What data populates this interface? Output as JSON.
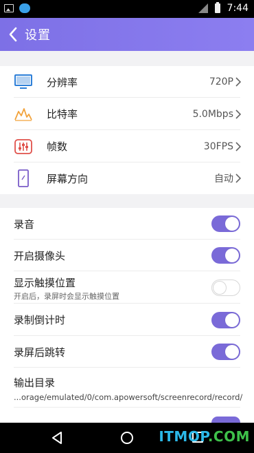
{
  "status_bar": {
    "time": "7:44"
  },
  "app_bar": {
    "title": "设置"
  },
  "video_settings": [
    {
      "label": "分辨率",
      "value": "720P",
      "icon": "monitor-icon",
      "color": "#2d7fd8"
    },
    {
      "label": "比特率",
      "value": "5.0Mbps",
      "icon": "bitrate-wave-icon",
      "color": "#f2a23a"
    },
    {
      "label": "帧数",
      "value": "30FPS",
      "icon": "sliders-icon",
      "color": "#e0504a"
    },
    {
      "label": "屏幕方向",
      "value": "自动",
      "icon": "phone-orientation-icon",
      "color": "#7a5cc8"
    }
  ],
  "toggles": {
    "record_audio": {
      "label": "录音",
      "on": true
    },
    "camera": {
      "label": "开启摄像头",
      "on": true
    },
    "show_touches": {
      "label": "显示触摸位置",
      "sub": "开启后，录屏时会显示触摸位置",
      "on": false
    },
    "countdown": {
      "label": "录制倒计时",
      "on": true
    },
    "jump_after": {
      "label": "录屏后跳转",
      "on": true
    }
  },
  "output": {
    "label": "输出目录",
    "path": "...orage/emulated/0/com.apowersoft/screenrecord/record/"
  },
  "watermark": {
    "text_itmop": "ITMOP",
    "text_com": ".COM",
    "color_itmop": "#2bb8e8",
    "color_com": "#3ec04a"
  },
  "colors": {
    "accent": "#7a6ad8"
  }
}
